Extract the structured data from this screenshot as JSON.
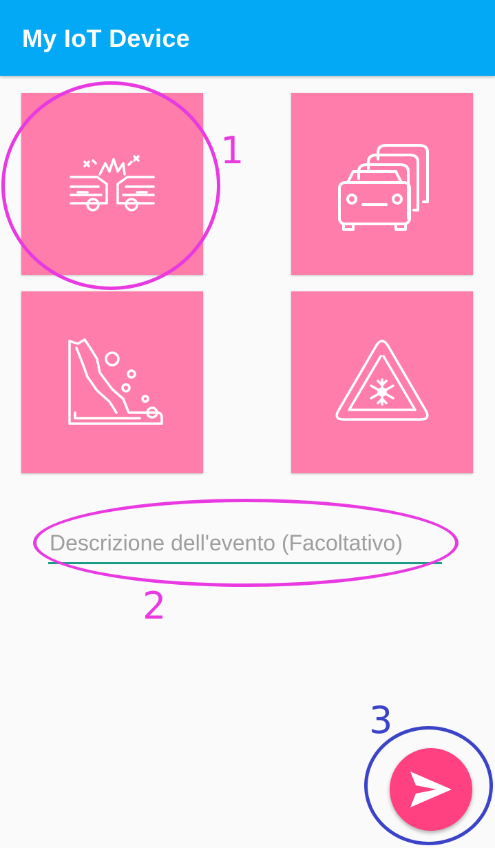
{
  "appbar": {
    "title": "My IoT Device"
  },
  "event_tiles": [
    {
      "icon": "car-crash-icon"
    },
    {
      "icon": "traffic-jam-icon"
    },
    {
      "icon": "landslide-icon"
    },
    {
      "icon": "ice-warning-icon"
    }
  ],
  "description": {
    "placeholder": "Descrizione dell'evento (Facoltativo)",
    "value": ""
  },
  "fab": {
    "icon": "send-icon"
  },
  "annotations": {
    "one": "1",
    "two": "2",
    "three": "3"
  },
  "colors": {
    "appbar": "#03a9f4",
    "tile": "#ff7daa",
    "fab": "#ff4081",
    "input_underline": "#1a9e8a",
    "annotation_pink": "#e93ae2",
    "annotation_blue": "#3b43c9"
  }
}
